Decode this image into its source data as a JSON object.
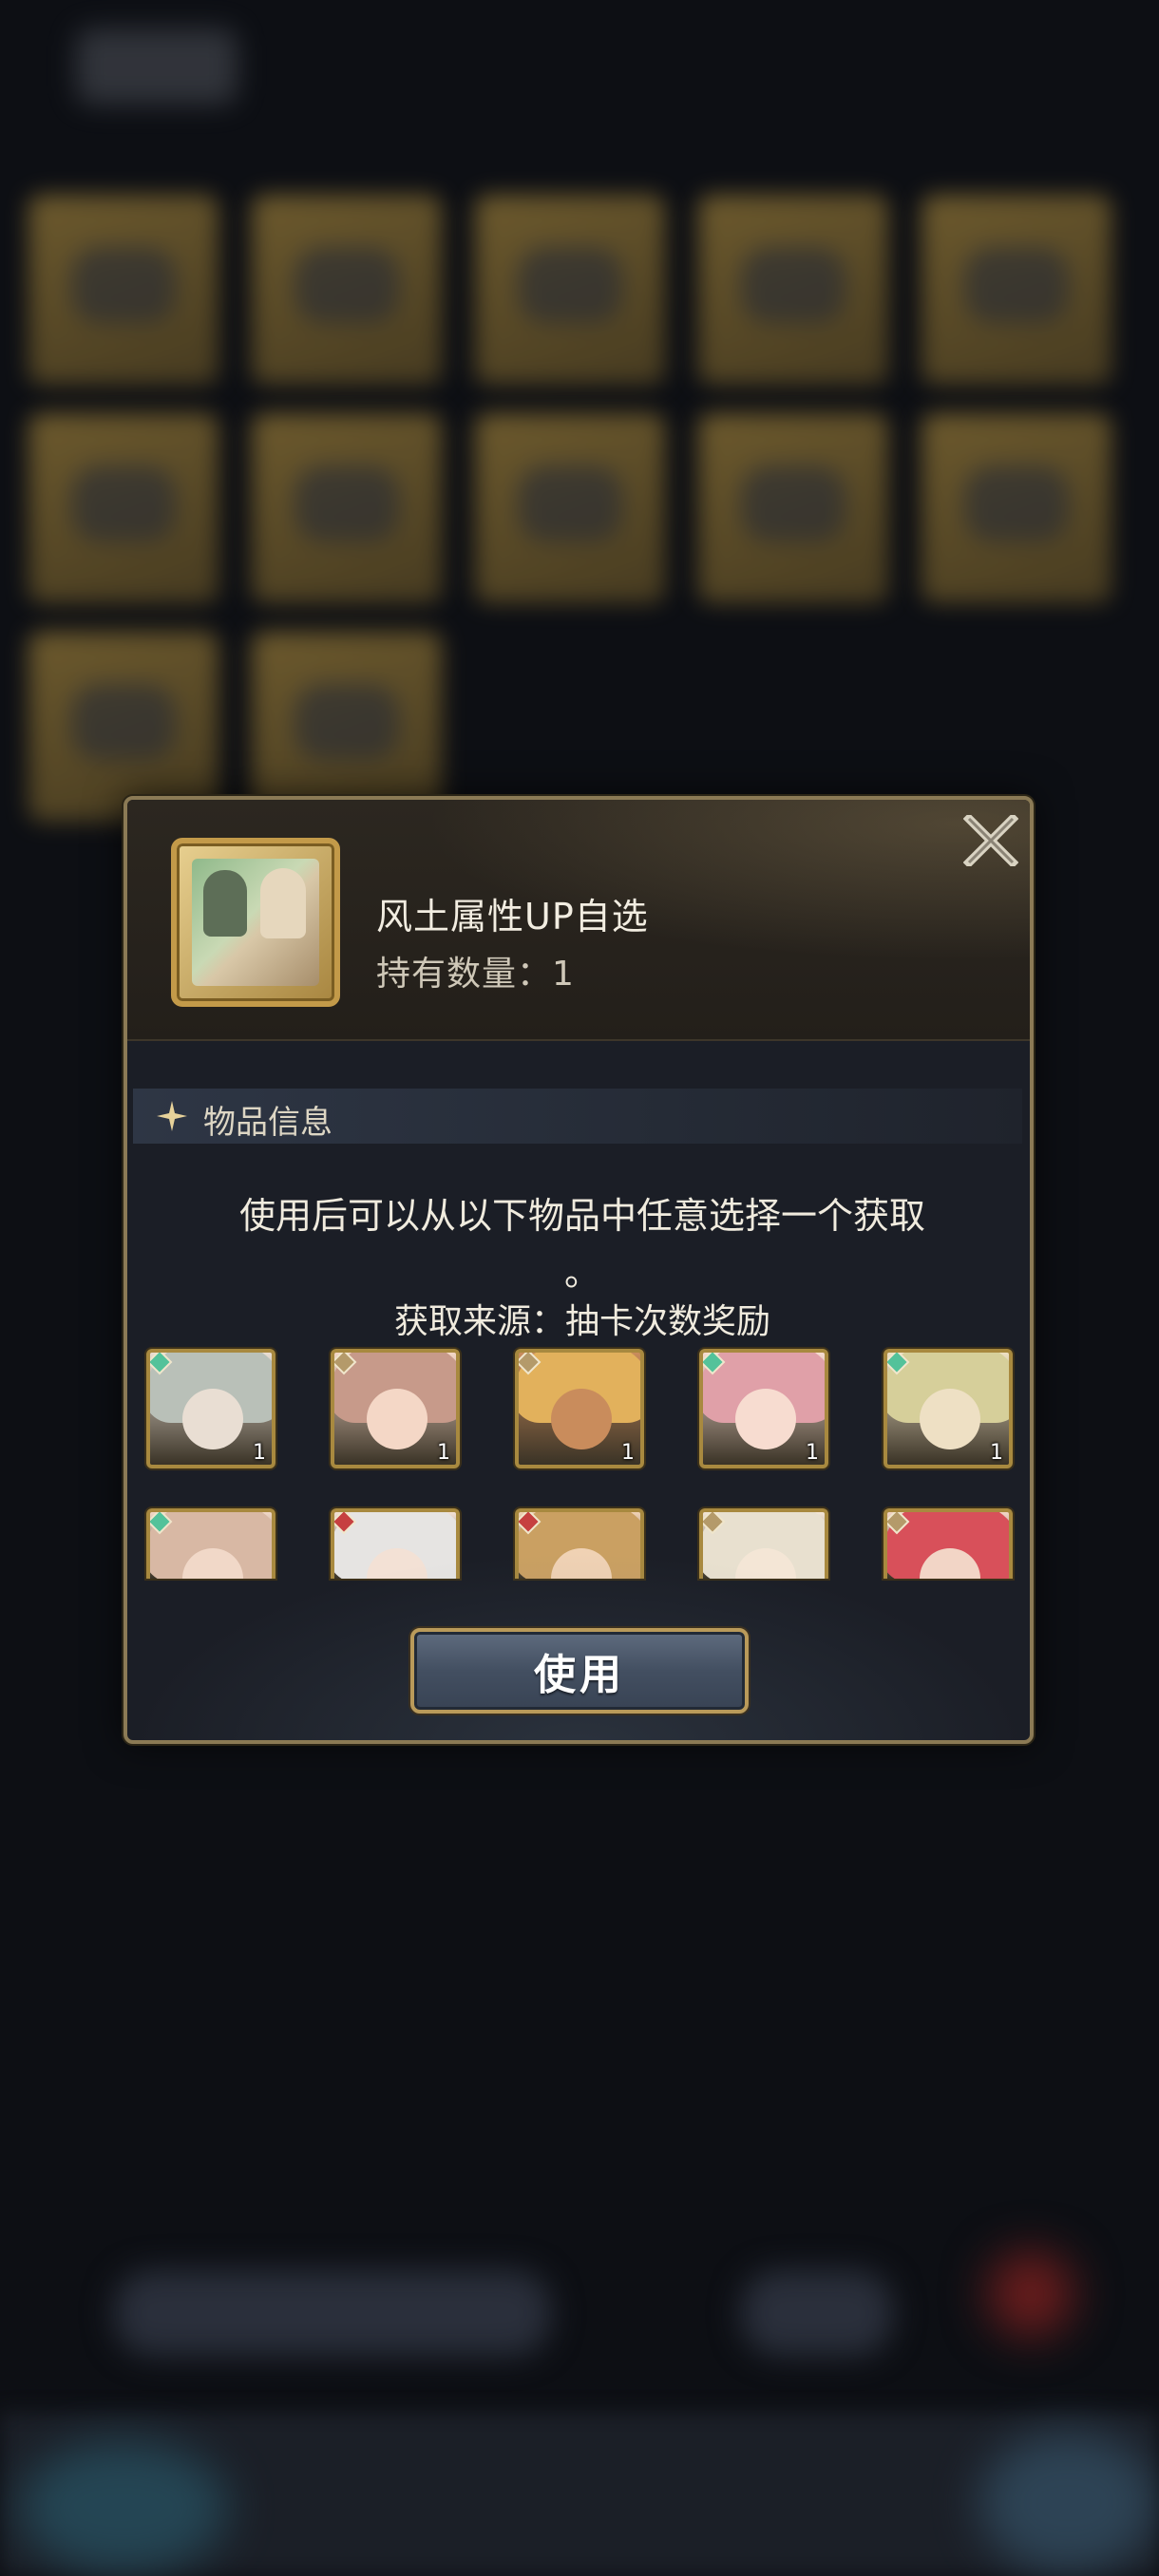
{
  "dialog": {
    "item_name": "风土属性UP自选",
    "item_count": "持有数量：1",
    "section_title": "物品信息",
    "description_line1": "使用后可以从以下物品中任意选择一个获取",
    "description_line2": "。",
    "source": "获取来源：抽卡次数奖励",
    "use_label": "使用"
  },
  "characters": [
    {
      "qty": "1",
      "element": "wind",
      "hair": "#b9c0b8",
      "face": "#e9ded3"
    },
    {
      "qty": "1",
      "element": "earth",
      "hair": "#c79a8a",
      "face": "#f4d7c6"
    },
    {
      "qty": "1",
      "element": "earth",
      "hair": "#e2b15c",
      "face": "#c98c5c"
    },
    {
      "qty": "1",
      "element": "wind",
      "hair": "#e0a0a8",
      "face": "#f7dcd0"
    },
    {
      "qty": "1",
      "element": "wind",
      "hair": "#d6cf9a",
      "face": "#eee0c4"
    },
    {
      "qty": "",
      "element": "wind",
      "hair": "#d8b8a4",
      "face": "#f1d8c8"
    },
    {
      "qty": "",
      "element": "fire",
      "hair": "#e6e4e2",
      "face": "#f3e1d5"
    },
    {
      "qty": "",
      "element": "fire",
      "hair": "#caa062",
      "face": "#f0d2b4"
    },
    {
      "qty": "",
      "element": "earth",
      "hair": "#e8e0cf",
      "face": "#f4e6d6"
    },
    {
      "qty": "",
      "element": "earth",
      "hair": "#d8505a",
      "face": "#f2d5c6"
    }
  ],
  "colors": {
    "frame_gold": "#8b7a55",
    "icon_gold": "#c39a49",
    "wind": "#53c29a",
    "fire": "#c64040",
    "earth": "#b49a6a"
  }
}
